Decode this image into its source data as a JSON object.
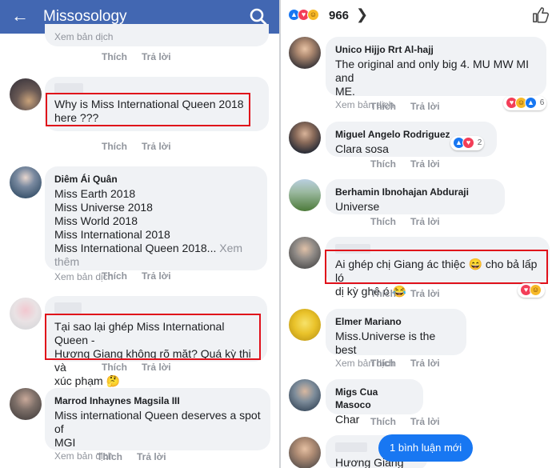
{
  "left": {
    "header": {
      "title": "Missosology"
    },
    "top_stub": {
      "translate": "Xem bản dịch",
      "like": "Thích",
      "reply": "Trả lời"
    },
    "comments": [
      {
        "name": "",
        "lines": [
          "Why is Miss International Queen 2018",
          "here ???"
        ],
        "translate": "",
        "like": "Thích",
        "reply": "Trả lời"
      },
      {
        "name": "Diêm Ái Quân",
        "lines": [
          "Miss Earth 2018",
          "Miss Universe 2018",
          "Miss World 2018",
          "Miss International 2018",
          "Miss International Queen 2018..."
        ],
        "see_more": "Xem thêm",
        "translate": "Xem bản dịch",
        "like": "Thích",
        "reply": "Trả lời"
      },
      {
        "name": "",
        "lines": [
          "Tại sao lại ghép Miss International Queen -",
          "Hương Giang không rõ mặt? Quá kỳ thị và",
          "xúc phạm 🤔"
        ],
        "translate": "",
        "like": "Thích",
        "reply": "Trả lời"
      },
      {
        "name": "Marrod Inhaynes Magsila III",
        "lines": [
          "Miss international Queen deserves a spot of",
          "MGI"
        ],
        "translate": "Xem bản dịch",
        "like": "Thích",
        "reply": "Trả lời"
      }
    ]
  },
  "right": {
    "header": {
      "count": "966"
    },
    "comments": [
      {
        "name": "Unico Hijjo Rrt Al-hajj",
        "lines": [
          "The original and only big 4. MU MW MI and",
          "ME."
        ],
        "translate": "Xem bản dịch",
        "like": "Thích",
        "reply": "Trả lời",
        "reactions": "6"
      },
      {
        "name": "Miguel Angelo Rodriguez",
        "lines": [
          "Clara sosa"
        ],
        "translate": "",
        "like": "Thích",
        "reply": "Trả lời",
        "reactions": "2"
      },
      {
        "name": "Berhamin Ibnohajan Abduraji",
        "lines": [
          "Universe"
        ],
        "translate": "",
        "like": "Thích",
        "reply": "Trả lời"
      },
      {
        "name": "",
        "lines": [
          "Ai ghép chị Giang ác thiệc 😄 cho bả lấp ló",
          "dị kỳ ghê ó 😂"
        ],
        "translate": "",
        "like": "Thích",
        "reply": "Trả lời"
      },
      {
        "name": "Elmer Mariano",
        "lines": [
          "Miss.Universe is the best"
        ],
        "translate": "Xem bản dịch",
        "like": "Thích",
        "reply": "Trả lời"
      },
      {
        "name": "Migs Cua Masoco",
        "lines": [
          "Char"
        ],
        "translate": "",
        "like": "Thích",
        "reply": "Trả lời"
      },
      {
        "name": "",
        "lines": [
          "Hương Giang"
        ],
        "translate": "",
        "like": "",
        "reply": ""
      }
    ],
    "new_comment_button": "1 bình luận mới"
  },
  "colors": {
    "header_blue": "#4267b2",
    "highlight_red": "#e0101a",
    "bubble": "#f0f2f5",
    "link_blue": "#1877f2"
  },
  "icons": [
    "back-arrow-icon",
    "search-icon",
    "like-reaction-icon",
    "love-reaction-icon",
    "haha-reaction-icon",
    "chevron-right-icon",
    "thumbs-up-icon"
  ]
}
